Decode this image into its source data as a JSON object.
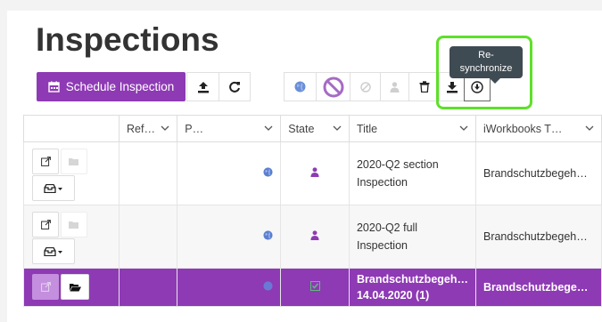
{
  "page": {
    "title": "Inspections"
  },
  "toolbar": {
    "schedule_label": "Schedule Inspection",
    "tooltip_line1": "Re-",
    "tooltip_line2": "synchronize"
  },
  "table": {
    "columns": [
      "Ref…",
      "P…",
      "State",
      "Title",
      "iWorkbooks T…"
    ],
    "rows": [
      {
        "title_line1": "2020-Q2 section",
        "title_line2": "Inspection",
        "workbook": "Brandschutzbegeh…"
      },
      {
        "title_line1": "2020-Q2 full",
        "title_line2": "Inspection",
        "workbook": "Brandschutzbegeh…"
      },
      {
        "title_line1": "Brandschutzbegeh…",
        "title_line2": "14.04.2020 (1)",
        "workbook": "Brandschutzbegeh…"
      }
    ]
  },
  "colors": {
    "accent": "#8e3ab4",
    "highlight": "#5ee02a",
    "tooltip": "#3f4b53"
  }
}
